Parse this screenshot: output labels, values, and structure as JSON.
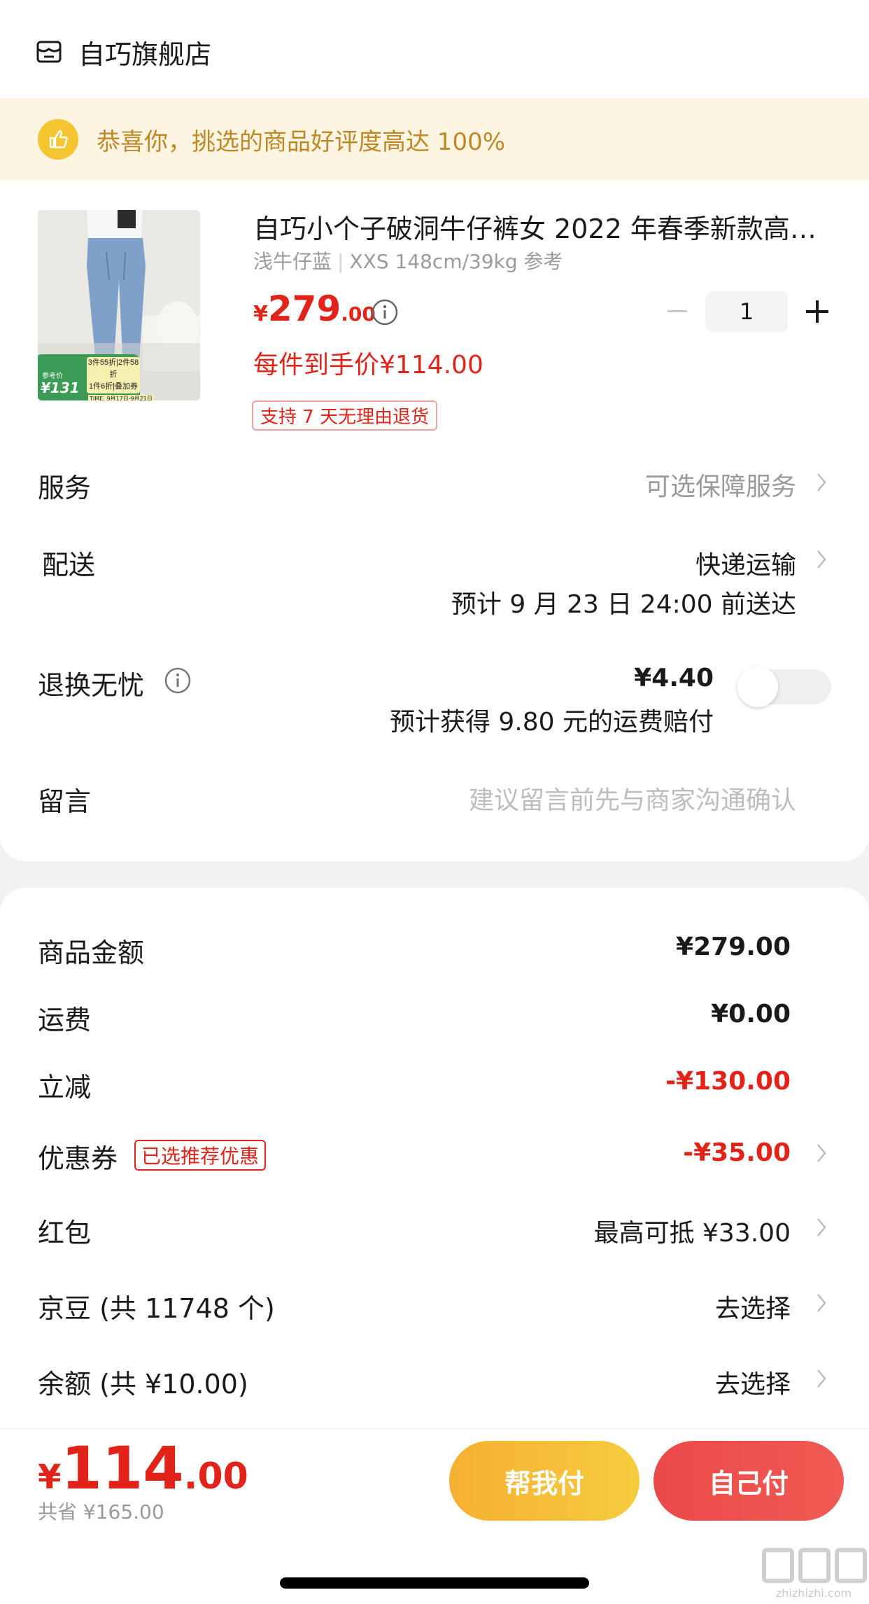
{
  "shop": {
    "name": "自巧旗舰店",
    "icon": "store-icon"
  },
  "banner": {
    "text": "恭喜你，挑选的商品好评度高达 100%",
    "icon": "thumbs-up-icon"
  },
  "product": {
    "title": "自巧小个子破洞牛仔裤女 2022 年春季新款高…",
    "color": "浅牛仔蓝",
    "size": "XXS 148cm/39kg 参考",
    "price_currency": "¥",
    "price_int": "279",
    "price_dec": ".00",
    "per_unit": "每件到手价¥114.00",
    "return_tag": "支持 7 天无理由退货",
    "quantity": "1",
    "image_badge": {
      "line1": "3件55折|2件58折",
      "line2": "1件6折|叠加券",
      "ref_label": "参考价",
      "ref_price": "¥131",
      "time": "TIME: 9月17日-9月21日"
    }
  },
  "rows": {
    "service": {
      "label": "服务",
      "value": "可选保障服务"
    },
    "delivery": {
      "label": "配送",
      "value": "快递运输",
      "eta": "预计 9 月 23 日 24:00 前送达"
    },
    "worry_free": {
      "label": "退换无忧",
      "price": "¥4.40",
      "desc": "预计获得 9.80 元的运费赔付"
    },
    "message": {
      "label": "留言",
      "placeholder": "建议留言前先与商家沟通确认"
    }
  },
  "summary": {
    "goods": {
      "label": "商品金额",
      "value": "¥279.00"
    },
    "shipping": {
      "label": "运费",
      "value": "¥0.00"
    },
    "discount": {
      "label": "立减",
      "value": "-¥130.00"
    },
    "coupon": {
      "label": "优惠券",
      "tag": "已选推荐优惠",
      "value": "-¥35.00"
    },
    "redpacket": {
      "label": "红包",
      "value": "最高可抵 ¥33.00"
    },
    "jingdou": {
      "label": "京豆 (共 11748 个)",
      "value": "去选择"
    },
    "balance": {
      "label": "余额 (共 ¥10.00)",
      "value": "去选择"
    }
  },
  "bottom": {
    "currency": "¥",
    "total_int": "114",
    "total_dec": ".00",
    "saved": "共省 ¥165.00",
    "help_pay": "帮我付",
    "self_pay": "自己付"
  },
  "watermark": {
    "text": "zhizhizhi.com"
  },
  "colors": {
    "accent_red": "#e2231a",
    "banner_bg": "#fdf5e2",
    "banner_text": "#bf8726",
    "help_btn": "#f5b032",
    "self_btn": "#ea4a4a"
  }
}
